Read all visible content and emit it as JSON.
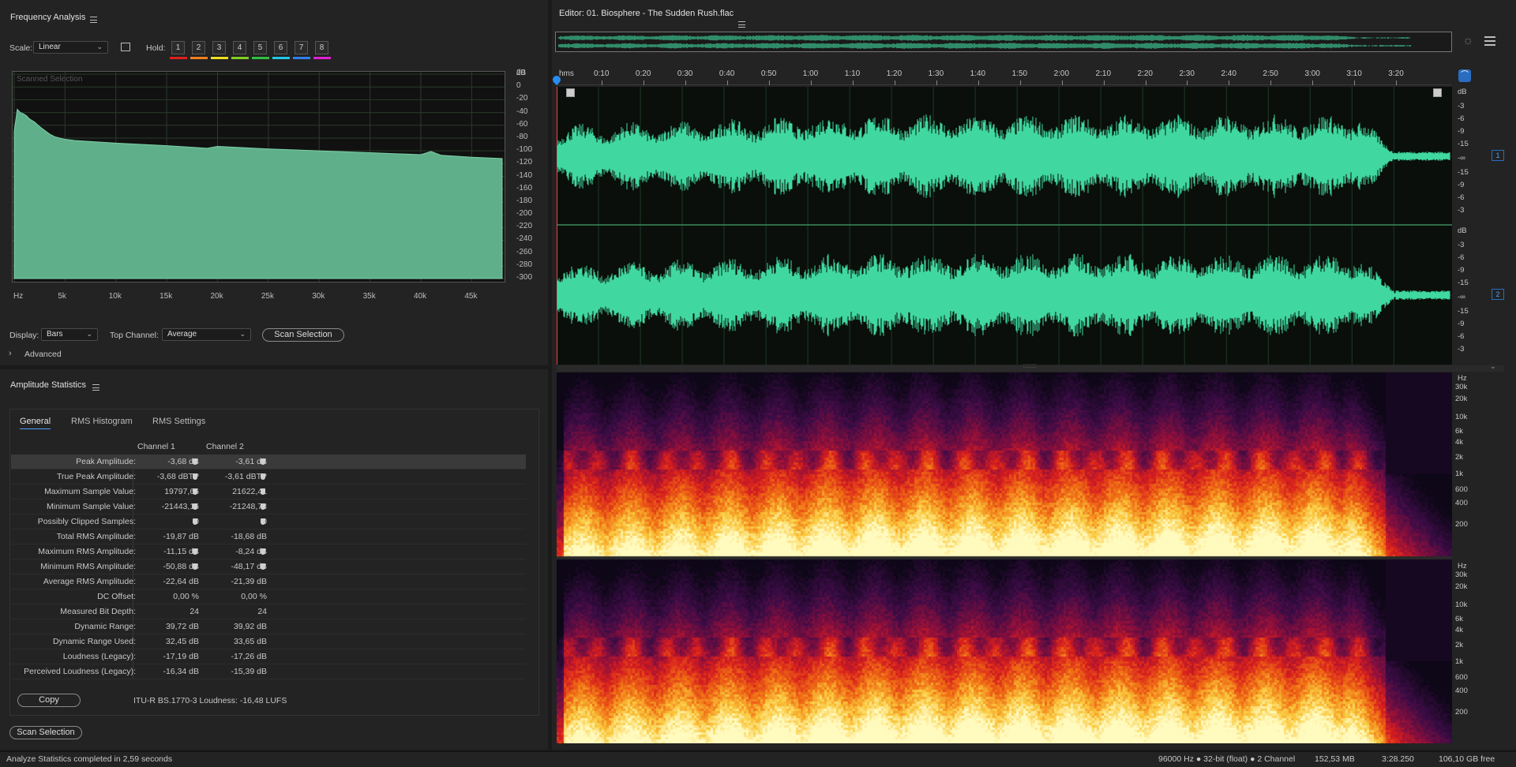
{
  "freq": {
    "title": "Frequency Analysis",
    "scale_label": "Scale:",
    "scale_value": "Linear",
    "hold_label": "Hold:",
    "holds": [
      {
        "n": "1",
        "color": "#e02020"
      },
      {
        "n": "2",
        "color": "#f08020"
      },
      {
        "n": "3",
        "color": "#f0e020"
      },
      {
        "n": "4",
        "color": "#80d020"
      },
      {
        "n": "5",
        "color": "#30c040"
      },
      {
        "n": "6",
        "color": "#20c8e8"
      },
      {
        "n": "7",
        "color": "#3080f0"
      },
      {
        "n": "8",
        "color": "#e020d0"
      }
    ],
    "plot_caption": "Scanned Selection",
    "db_unit": "dB",
    "db_ticks": [
      "20",
      "0",
      "-20",
      "-40",
      "-60",
      "-80",
      "-100",
      "-120",
      "-140",
      "-160",
      "-180",
      "-200",
      "-220",
      "-240",
      "-260",
      "-280",
      "-300"
    ],
    "hz_ticks": [
      "Hz",
      "5k",
      "10k",
      "15k",
      "20k",
      "25k",
      "30k",
      "35k",
      "40k",
      "45k"
    ],
    "display_label": "Display:",
    "display_value": "Bars",
    "top_channel_label": "Top Channel:",
    "top_channel_value": "Average",
    "scan_button": "Scan Selection",
    "advanced_label": "Advanced",
    "chart_data": {
      "type": "area",
      "title": "",
      "xlabel": "Hz",
      "ylabel": "dB",
      "xlim": [
        0,
        48000
      ],
      "ylim": [
        -300,
        20
      ],
      "x": [
        0,
        300,
        600,
        900,
        1200,
        1500,
        2000,
        2500,
        3000,
        3500,
        4000,
        5000,
        6000,
        8000,
        10000,
        15000,
        19000,
        20000,
        25000,
        30000,
        35000,
        40000,
        41000,
        42000,
        45000,
        48000
      ],
      "y": [
        -70,
        -35,
        -40,
        -42,
        -45,
        -50,
        -55,
        -62,
        -68,
        -74,
        -78,
        -82,
        -84,
        -86,
        -88,
        -92,
        -96,
        -93,
        -97,
        -100,
        -103,
        -106,
        -101,
        -107,
        -110,
        -112
      ]
    }
  },
  "amp": {
    "title": "Amplitude Statistics",
    "tabs": [
      "General",
      "RMS Histogram",
      "RMS Settings"
    ],
    "ch1": "Channel 1",
    "ch2": "Channel 2",
    "rows": [
      {
        "label": "Peak Amplitude:",
        "c1": "-3,68 dB",
        "c2": "-3,61 dB"
      },
      {
        "label": "True Peak Amplitude:",
        "c1": "-3,68 dBTP",
        "c2": "-3,61 dBTP"
      },
      {
        "label": "Maximum Sample Value:",
        "c1": "19797,66",
        "c2": "21622,41"
      },
      {
        "label": "Minimum Sample Value:",
        "c1": "-21443,16",
        "c2": "-21248,73"
      },
      {
        "label": "Possibly Clipped Samples:",
        "c1": "0",
        "c2": "0"
      },
      {
        "label": "Total RMS Amplitude:",
        "c1": "-19,87 dB",
        "c2": "-18,68 dB"
      },
      {
        "label": "Maximum RMS Amplitude:",
        "c1": "-11,15 dB",
        "c2": "-8,24 dB"
      },
      {
        "label": "Minimum RMS Amplitude:",
        "c1": "-50,88 dB",
        "c2": "-48,17 dB"
      },
      {
        "label": "Average RMS Amplitude:",
        "c1": "-22,64 dB",
        "c2": "-21,39 dB"
      },
      {
        "label": "DC Offset:",
        "c1": "0,00 %",
        "c2": "0,00 %"
      },
      {
        "label": "Measured Bit Depth:",
        "c1": "24",
        "c2": "24"
      },
      {
        "label": "Dynamic Range:",
        "c1": "39,72 dB",
        "c2": "39,92 dB"
      },
      {
        "label": "Dynamic Range Used:",
        "c1": "32,45 dB",
        "c2": "33,65 dB"
      },
      {
        "label": "Loudness (Legacy):",
        "c1": "-17,19 dB",
        "c2": "-17,26 dB"
      },
      {
        "label": "Perceived Loudness (Legacy):",
        "c1": "-16,34 dB",
        "c2": "-15,39 dB"
      }
    ],
    "copy_button": "Copy",
    "itu_text": "ITU-R BS.1770-3 Loudness: -16,48 LUFS",
    "scan_button": "Scan Selection"
  },
  "editor": {
    "title": "Editor: 01. Biosphere - The Sudden Rush.flac",
    "ruler_unit": "hms",
    "ruler_ticks": [
      "0:10",
      "0:20",
      "0:30",
      "0:40",
      "0:50",
      "1:00",
      "1:10",
      "1:20",
      "1:30",
      "1:40",
      "1:50",
      "2:00",
      "2:10",
      "2:20",
      "2:30",
      "2:40",
      "2:50",
      "3:00",
      "3:10",
      "3:20"
    ],
    "db_labels": [
      "dB",
      "-3",
      "-6",
      "-9",
      "-15",
      "-∞",
      "-15",
      "-9",
      "-6",
      "-3"
    ],
    "hz_labels": [
      "Hz",
      "30k",
      "20k",
      "10k",
      "6k",
      "4k",
      "2k",
      "1k",
      "600",
      "400",
      "200"
    ],
    "channel_badges": [
      "1",
      "2"
    ],
    "waveform_color": "#40d8a0",
    "scroll_handle": "::::::::"
  },
  "status": {
    "left": "Analyze Statistics completed in 2,59 seconds",
    "format": "96000 Hz ● 32-bit (float) ● 2 Channel",
    "size": "152,53 MB",
    "duration": "3:28.250",
    "free": "106,10 GB free"
  }
}
